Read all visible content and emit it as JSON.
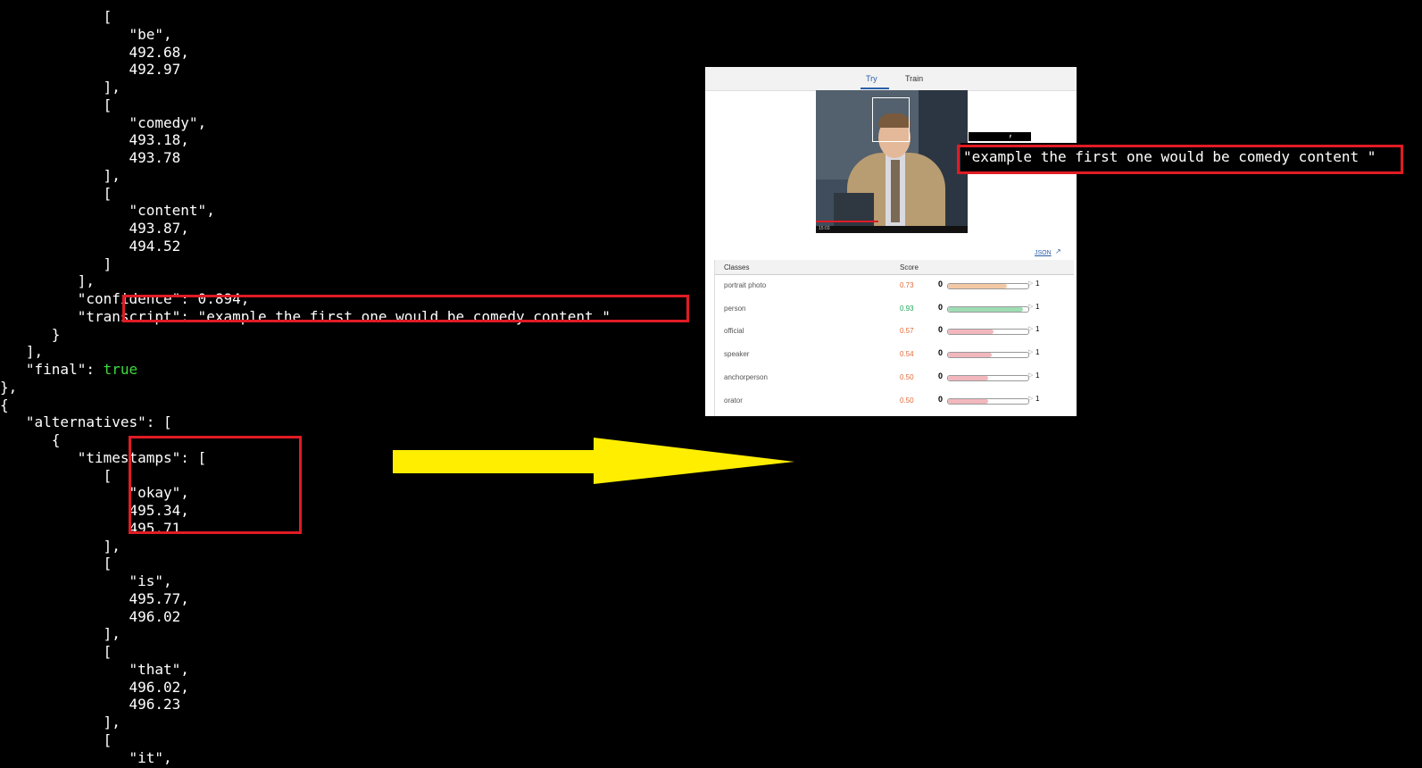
{
  "code_lines": [
    "            [",
    "               \"be\",",
    "               492.68,",
    "               492.97",
    "            ],",
    "            [",
    "               \"comedy\",",
    "               493.18,",
    "               493.78",
    "            ],",
    "            [",
    "               \"content\",",
    "               493.87,",
    "               494.52",
    "            ]",
    "         ],",
    "         \"confidence\": 0.894,",
    "         \"transcript\": \"example the first one would be comedy content \"",
    "      }",
    "   ],",
    "   \"final\": ",
    "},",
    "{",
    "   \"alternatives\": [",
    "      {",
    "         \"timestamps\": [",
    "            [",
    "               \"okay\",",
    "               495.34,",
    "               495.71",
    "            ],",
    "            [",
    "               \"is\",",
    "               495.77,",
    "               496.02",
    "            ],",
    "            [",
    "               \"that\",",
    "               496.02,",
    "               496.23",
    "            ],",
    "            [",
    "               \"it\","
  ],
  "final_value": "true",
  "panel": {
    "tabs": [
      "Try",
      "Train"
    ],
    "video_time": "15:03",
    "json_link": "JSON",
    "columns": [
      "Classes",
      "Score"
    ],
    "rows": [
      {
        "class": "portrait photo",
        "score": "0.73",
        "fill": 0.73,
        "color": "#f3c9a5",
        "score_color": "orange"
      },
      {
        "class": "person",
        "score": "0.93",
        "fill": 0.93,
        "color": "#9fdcb3",
        "score_color": "green"
      },
      {
        "class": "official",
        "score": "0.57",
        "fill": 0.57,
        "color": "#f2b7bd",
        "score_color": "orange"
      },
      {
        "class": "speaker",
        "score": "0.54",
        "fill": 0.54,
        "color": "#f2b7bd",
        "score_color": "orange"
      },
      {
        "class": "anchorperson",
        "score": "0.50",
        "fill": 0.5,
        "color": "#f2b7bd",
        "score_color": "orange"
      },
      {
        "class": "orator",
        "score": "0.50",
        "fill": 0.5,
        "color": "#f2b7bd",
        "score_color": "orange"
      }
    ],
    "zero": "0",
    "one": "1"
  },
  "overlay": {
    "transcript_text": "\"example the first one would be comedy content \"",
    "fragment_text": "      ,"
  },
  "colors": {
    "highlight": "#e01b24",
    "arrow": "#ffee00",
    "json_true": "#3cdc3c"
  }
}
